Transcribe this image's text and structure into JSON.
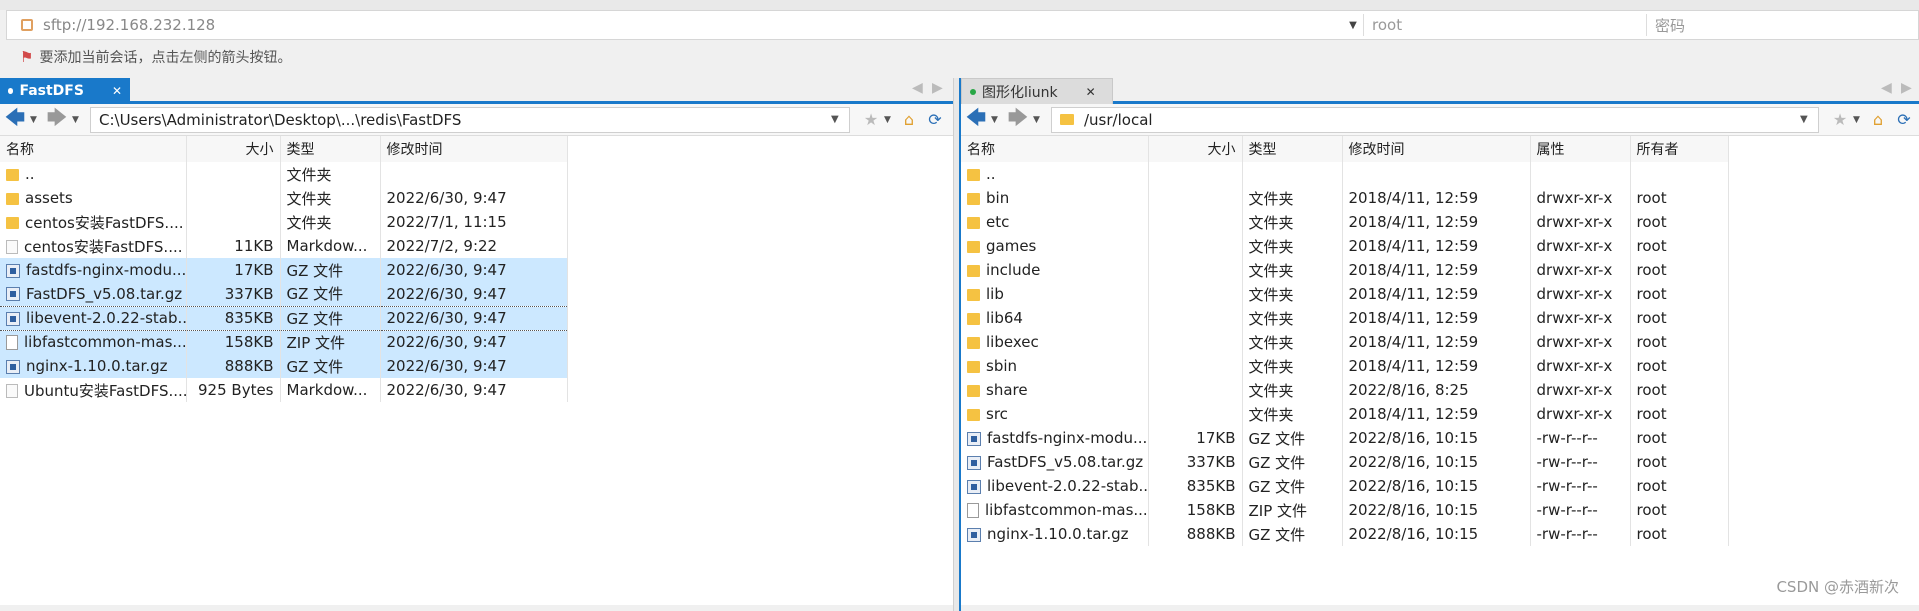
{
  "session": {
    "url": "sftp://192.168.232.128",
    "user_placeholder": "root",
    "password_placeholder": "密码",
    "hint": "要添加当前会话，点击左侧的箭头按钮。"
  },
  "left": {
    "tab": "FastDFS",
    "path": "C:\\Users\\Administrator\\Desktop\\...\\redis\\FastDFS",
    "columns": [
      "名称",
      "大小",
      "类型",
      "修改时间"
    ],
    "rows": [
      {
        "icon": "folder-icon",
        "name": "..",
        "size": "",
        "type": "文件夹",
        "modified": "",
        "state": ""
      },
      {
        "icon": "folder-icon",
        "name": "assets",
        "size": "",
        "type": "文件夹",
        "modified": "2022/6/30, 9:47",
        "state": ""
      },
      {
        "icon": "folder-icon",
        "name": "centos安装FastDFS....",
        "size": "",
        "type": "文件夹",
        "modified": "2022/7/1, 11:15",
        "state": ""
      },
      {
        "icon": "markdown-file-icon",
        "name": "centos安装FastDFS....",
        "size": "11KB",
        "type": "Markdow...",
        "modified": "2022/7/2, 9:22",
        "state": ""
      },
      {
        "icon": "archive-file-icon",
        "name": "fastdfs-nginx-modu...",
        "size": "17KB",
        "type": "GZ 文件",
        "modified": "2022/6/30, 9:47",
        "state": "selected"
      },
      {
        "icon": "archive-file-icon",
        "name": "FastDFS_v5.08.tar.gz",
        "size": "337KB",
        "type": "GZ 文件",
        "modified": "2022/6/30, 9:47",
        "state": "selected"
      },
      {
        "icon": "archive-file-icon",
        "name": "libevent-2.0.22-stab...",
        "size": "835KB",
        "type": "GZ 文件",
        "modified": "2022/6/30, 9:47",
        "state": "focused"
      },
      {
        "icon": "zip-file-icon",
        "name": "libfastcommon-mas...",
        "size": "158KB",
        "type": "ZIP 文件",
        "modified": "2022/6/30, 9:47",
        "state": "selected"
      },
      {
        "icon": "archive-file-icon",
        "name": "nginx-1.10.0.tar.gz",
        "size": "888KB",
        "type": "GZ 文件",
        "modified": "2022/6/30, 9:47",
        "state": "selected"
      },
      {
        "icon": "markdown-file-icon",
        "name": "Ubuntu安装FastDFS....",
        "size": "925 Bytes",
        "type": "Markdow...",
        "modified": "2022/6/30, 9:47",
        "state": ""
      }
    ]
  },
  "right": {
    "tab": "图形化liunk",
    "path": "/usr/local",
    "columns": [
      "名称",
      "大小",
      "类型",
      "修改时间",
      "属性",
      "所有者"
    ],
    "rows": [
      {
        "icon": "folder-icon",
        "name": "..",
        "size": "",
        "type": "",
        "modified": "",
        "perm": "",
        "owner": ""
      },
      {
        "icon": "folder-icon",
        "name": "bin",
        "size": "",
        "type": "文件夹",
        "modified": "2018/4/11, 12:59",
        "perm": "drwxr-xr-x",
        "owner": "root"
      },
      {
        "icon": "folder-icon",
        "name": "etc",
        "size": "",
        "type": "文件夹",
        "modified": "2018/4/11, 12:59",
        "perm": "drwxr-xr-x",
        "owner": "root"
      },
      {
        "icon": "folder-icon",
        "name": "games",
        "size": "",
        "type": "文件夹",
        "modified": "2018/4/11, 12:59",
        "perm": "drwxr-xr-x",
        "owner": "root"
      },
      {
        "icon": "folder-icon",
        "name": "include",
        "size": "",
        "type": "文件夹",
        "modified": "2018/4/11, 12:59",
        "perm": "drwxr-xr-x",
        "owner": "root"
      },
      {
        "icon": "folder-icon",
        "name": "lib",
        "size": "",
        "type": "文件夹",
        "modified": "2018/4/11, 12:59",
        "perm": "drwxr-xr-x",
        "owner": "root"
      },
      {
        "icon": "folder-icon",
        "name": "lib64",
        "size": "",
        "type": "文件夹",
        "modified": "2018/4/11, 12:59",
        "perm": "drwxr-xr-x",
        "owner": "root"
      },
      {
        "icon": "folder-icon",
        "name": "libexec",
        "size": "",
        "type": "文件夹",
        "modified": "2018/4/11, 12:59",
        "perm": "drwxr-xr-x",
        "owner": "root"
      },
      {
        "icon": "folder-icon",
        "name": "sbin",
        "size": "",
        "type": "文件夹",
        "modified": "2018/4/11, 12:59",
        "perm": "drwxr-xr-x",
        "owner": "root"
      },
      {
        "icon": "folder-icon",
        "name": "share",
        "size": "",
        "type": "文件夹",
        "modified": "2022/8/16, 8:25",
        "perm": "drwxr-xr-x",
        "owner": "root"
      },
      {
        "icon": "folder-icon",
        "name": "src",
        "size": "",
        "type": "文件夹",
        "modified": "2018/4/11, 12:59",
        "perm": "drwxr-xr-x",
        "owner": "root"
      },
      {
        "icon": "archive-file-icon",
        "name": "fastdfs-nginx-modu...",
        "size": "17KB",
        "type": "GZ 文件",
        "modified": "2022/8/16, 10:15",
        "perm": "-rw-r--r--",
        "owner": "root"
      },
      {
        "icon": "archive-file-icon",
        "name": "FastDFS_v5.08.tar.gz",
        "size": "337KB",
        "type": "GZ 文件",
        "modified": "2022/8/16, 10:15",
        "perm": "-rw-r--r--",
        "owner": "root"
      },
      {
        "icon": "archive-file-icon",
        "name": "libevent-2.0.22-stab...",
        "size": "835KB",
        "type": "GZ 文件",
        "modified": "2022/8/16, 10:15",
        "perm": "-rw-r--r--",
        "owner": "root"
      },
      {
        "icon": "zip-file-icon",
        "name": "libfastcommon-mas...",
        "size": "158KB",
        "type": "ZIP 文件",
        "modified": "2022/8/16, 10:15",
        "perm": "-rw-r--r--",
        "owner": "root"
      },
      {
        "icon": "archive-file-icon",
        "name": "nginx-1.10.0.tar.gz",
        "size": "888KB",
        "type": "GZ 文件",
        "modified": "2022/8/16, 10:15",
        "perm": "-rw-r--r--",
        "owner": "root"
      }
    ]
  },
  "watermark": "CSDN @赤酒新次",
  "colors": {
    "accent": "#1979ca",
    "selection": "#cce8ff",
    "folder": "#f5c242"
  }
}
